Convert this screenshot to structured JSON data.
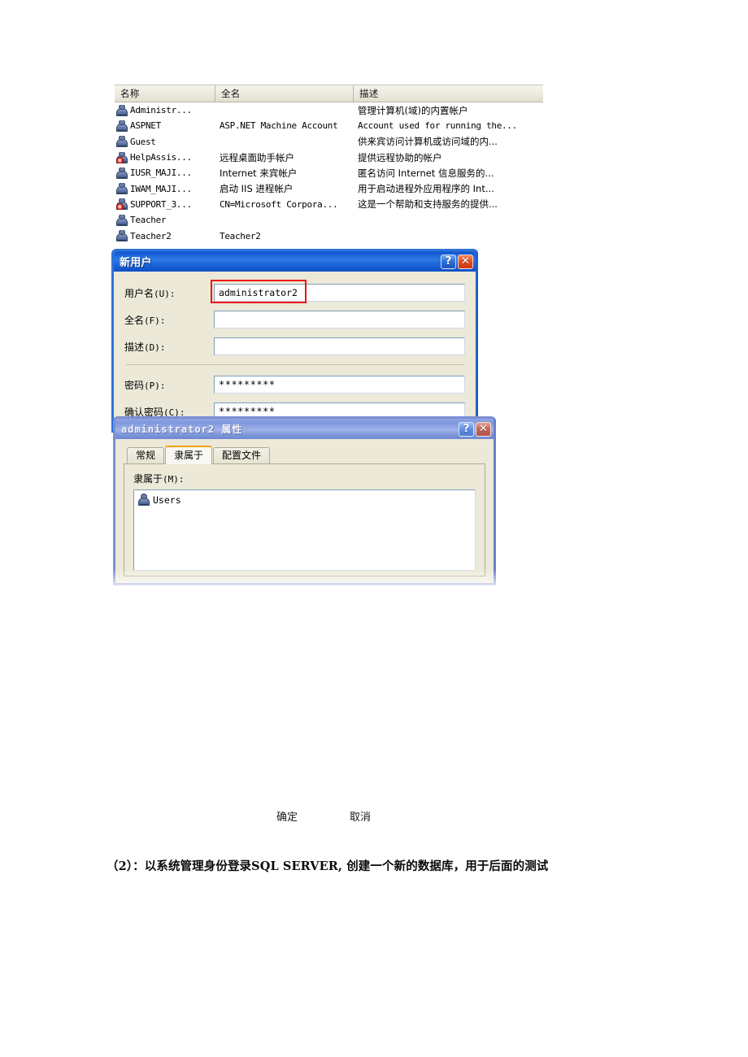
{
  "user_list": {
    "columns": [
      "名称",
      "全名",
      "描述"
    ],
    "rows": [
      {
        "icon": "user-icon",
        "disabled": false,
        "name": "Administr...",
        "full_name": "",
        "description": "管理计算机(域)的内置帐户",
        "desc_cjk": true
      },
      {
        "icon": "user-icon",
        "disabled": false,
        "name": "ASPNET",
        "full_name": "ASP.NET Machine Account",
        "description": "Account used for running the...",
        "desc_cjk": false
      },
      {
        "icon": "user-icon",
        "disabled": false,
        "name": "Guest",
        "full_name": "",
        "description": "供来宾访问计算机或访问域的内...",
        "desc_cjk": true
      },
      {
        "icon": "user-icon-disabled",
        "disabled": true,
        "name": "HelpAssis...",
        "full_name": "远程桌面助手帐户",
        "description": "提供远程协助的帐户",
        "desc_cjk": true
      },
      {
        "icon": "user-icon",
        "disabled": false,
        "name": "IUSR_MAJI...",
        "full_name": "Internet 来宾帐户",
        "description": "匿名访问 Internet 信息服务的...",
        "desc_cjk": true
      },
      {
        "icon": "user-icon",
        "disabled": false,
        "name": "IWAM_MAJI...",
        "full_name": "启动 IIS 进程帐户",
        "description": "用于启动进程外应用程序的 Int...",
        "desc_cjk": true
      },
      {
        "icon": "user-icon-disabled",
        "disabled": true,
        "name": "SUPPORT_3...",
        "full_name": "CN=Microsoft Corpora...",
        "description": "这是一个帮助和支持服务的提供...",
        "desc_cjk": true
      },
      {
        "icon": "user-icon",
        "disabled": false,
        "name": "Teacher",
        "full_name": "",
        "description": "",
        "desc_cjk": false
      },
      {
        "icon": "user-icon",
        "disabled": false,
        "name": "Teacher2",
        "full_name": "Teacher2",
        "description": "",
        "desc_cjk": false
      }
    ]
  },
  "new_user_dialog": {
    "title": "新用户",
    "help_button": "?",
    "close_button": "✕",
    "fields": [
      {
        "label": "用户名",
        "mnemonic": "(U):",
        "value": "administrator2",
        "type": "text",
        "highlighted": true
      },
      {
        "label": "全名",
        "mnemonic": "(F):",
        "value": "",
        "type": "text",
        "highlighted": false
      },
      {
        "label": "描述",
        "mnemonic": "(D):",
        "value": "",
        "type": "text",
        "highlighted": false
      },
      {
        "label": "密码",
        "mnemonic": "(P):",
        "value": "*********",
        "type": "password",
        "highlighted": false
      },
      {
        "label": "确认密码",
        "mnemonic": "(C):",
        "value": "*********",
        "type": "password",
        "highlighted": false
      }
    ],
    "highlight_color": "#ee1111"
  },
  "properties_dialog": {
    "title": "administrator2 属性",
    "help_button": "?",
    "close_button": "✕",
    "tabs": [
      {
        "label": "常规",
        "active": false
      },
      {
        "label": "隶属于",
        "active": true
      },
      {
        "label": "配置文件",
        "active": false
      }
    ],
    "active_tab_accent": "#f4a118",
    "member_of": {
      "label": "隶属于",
      "mnemonic": "(M):",
      "items": [
        {
          "icon": "group-user-icon",
          "name": "Users"
        }
      ]
    }
  },
  "footer": {
    "ok_label": "确定",
    "cancel_label": "取消"
  },
  "caption": {
    "text": "（2）：以系统管理身份登录SQL SERVER, 创建一个新的数据库，用于后面的测试"
  }
}
